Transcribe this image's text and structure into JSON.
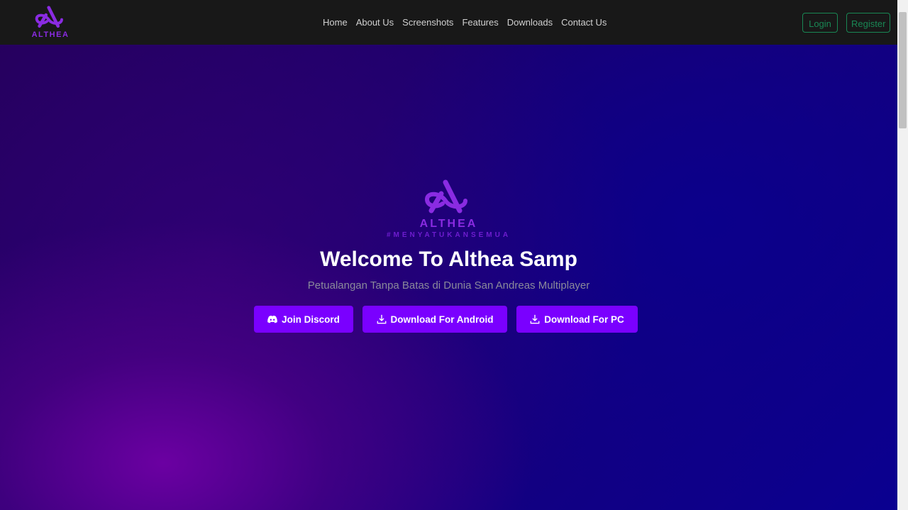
{
  "brand": {
    "name": "ALTHEA",
    "logo_icon": "althea-logo-icon"
  },
  "nav": {
    "items": [
      {
        "label": "Home"
      },
      {
        "label": "About Us"
      },
      {
        "label": "Screenshots"
      },
      {
        "label": "Features"
      },
      {
        "label": "Downloads"
      },
      {
        "label": "Contact Us"
      }
    ],
    "login_label": "Login",
    "register_label": "Register"
  },
  "hero": {
    "logo_name": "ALTHEA",
    "tagline": "#MENYATUKANSEMUA",
    "title": "Welcome To Althea Samp",
    "subtitle": "Petualangan Tanpa Batas di Dunia San Andreas Multiplayer",
    "buttons": {
      "discord": {
        "label": "Join Discord",
        "icon": "discord-icon"
      },
      "android": {
        "label": "Download For Android",
        "icon": "download-icon"
      },
      "pc": {
        "label": "Download For PC",
        "icon": "download-icon"
      }
    }
  },
  "colors": {
    "accent": "#7a00ff",
    "brand_purple": "#8a2be2",
    "outline_green": "#198754",
    "navbar_bg": "#181818"
  }
}
